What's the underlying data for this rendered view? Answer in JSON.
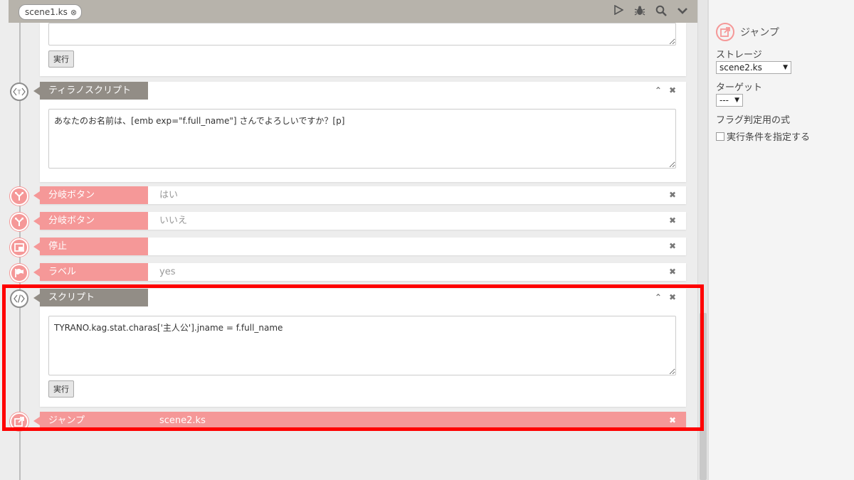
{
  "toolbar": {
    "tab_label": "scene1.ks",
    "tab_close": "⊗",
    "icons": [
      "play-icon",
      "debug-bug-icon",
      "search-icon",
      "chevron-down-icon"
    ]
  },
  "blocks": {
    "top_run_label": "実行",
    "tyrano": {
      "label": "ティラノスクリプト",
      "text": "あなたのお名前は、[emb exp=\"f.full_name\"] さんでよろしいですか？[p]",
      "collapse": "⌃",
      "close": "✖"
    },
    "branch1": {
      "label": "分岐ボタン",
      "value": "はい",
      "close": "✖"
    },
    "branch2": {
      "label": "分岐ボタン",
      "value": "いいえ",
      "close": "✖"
    },
    "stop": {
      "label": "停止",
      "close": "✖"
    },
    "label": {
      "label": "ラベル",
      "value": "yes",
      "close": "✖"
    },
    "script": {
      "label": "スクリプト",
      "text": "TYRANO.kag.stat.charas['主人公'].jname = f.full_name",
      "run_label": "実行",
      "collapse": "⌃",
      "close": "✖"
    },
    "jump": {
      "label": "ジャンプ",
      "value": "scene2.ks",
      "close": "✖"
    }
  },
  "panel": {
    "title": "ジャンプ",
    "storage_label": "ストレージ",
    "storage_value": "scene2.ks",
    "target_label": "ターゲット",
    "target_value": "---",
    "flag_label": "フラグ判定用の式",
    "condition_label": "実行条件を指定する"
  },
  "colors": {
    "accent_pink": "#f59898",
    "tag_gray": "#928d86",
    "toolbar": "#b7b3ab",
    "highlight": "#ff0000"
  }
}
